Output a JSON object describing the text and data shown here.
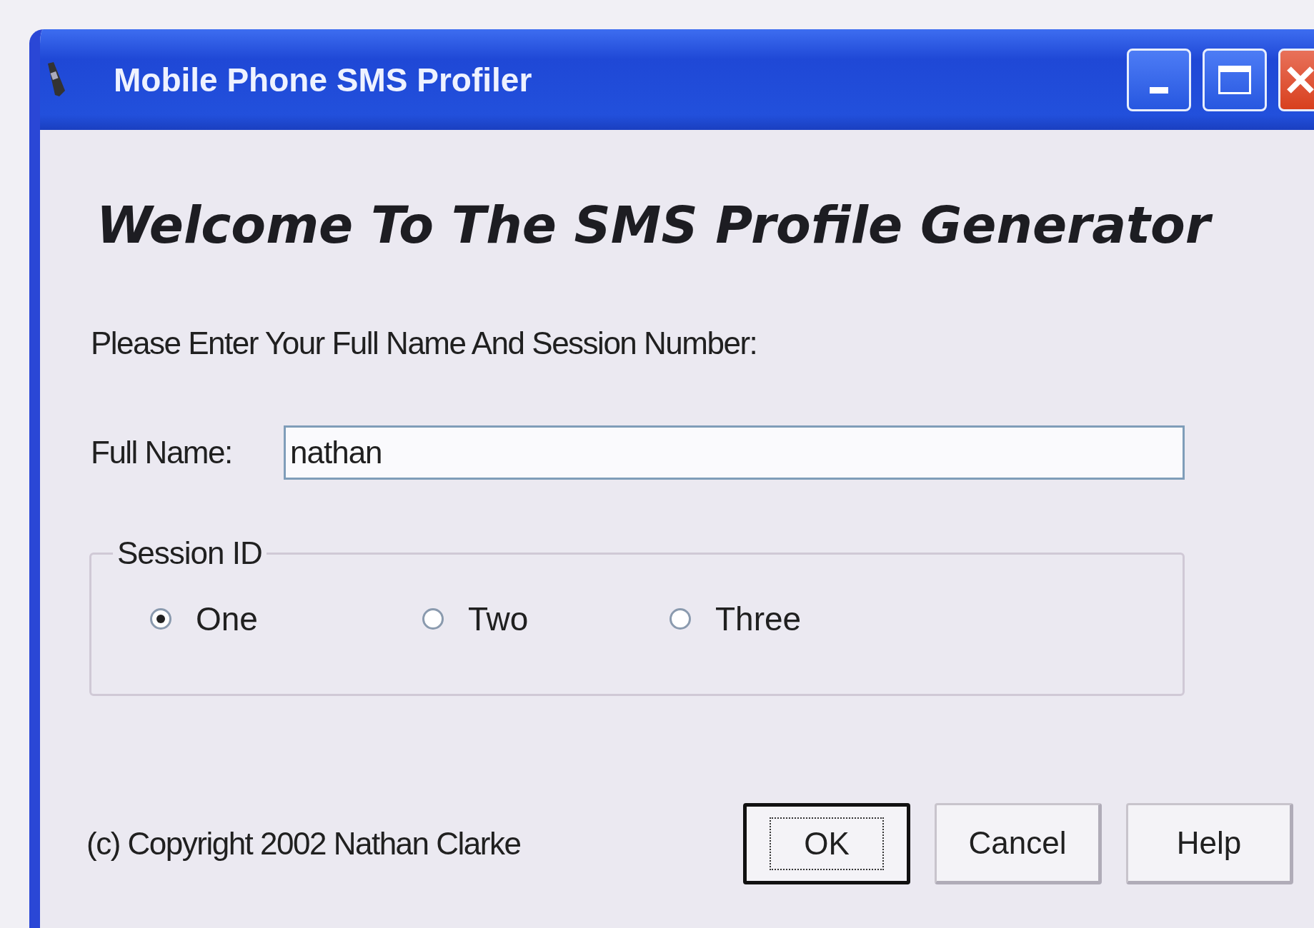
{
  "window": {
    "title": "Mobile Phone SMS Profiler"
  },
  "heading": "Welcome To The SMS Profile Generator",
  "instruction": "Please Enter Your Full Name And Session Number:",
  "full_name": {
    "label": "Full Name:",
    "value": "nathan"
  },
  "session": {
    "legend": "Session ID",
    "options": [
      {
        "label": "One",
        "selected": true
      },
      {
        "label": "Two",
        "selected": false
      },
      {
        "label": "Three",
        "selected": false
      }
    ]
  },
  "copyright": "(c) Copyright 2002 Nathan Clarke",
  "buttons": [
    {
      "label": "OK",
      "default": true
    },
    {
      "label": "Cancel",
      "default": false
    },
    {
      "label": "Help",
      "default": false
    }
  ]
}
